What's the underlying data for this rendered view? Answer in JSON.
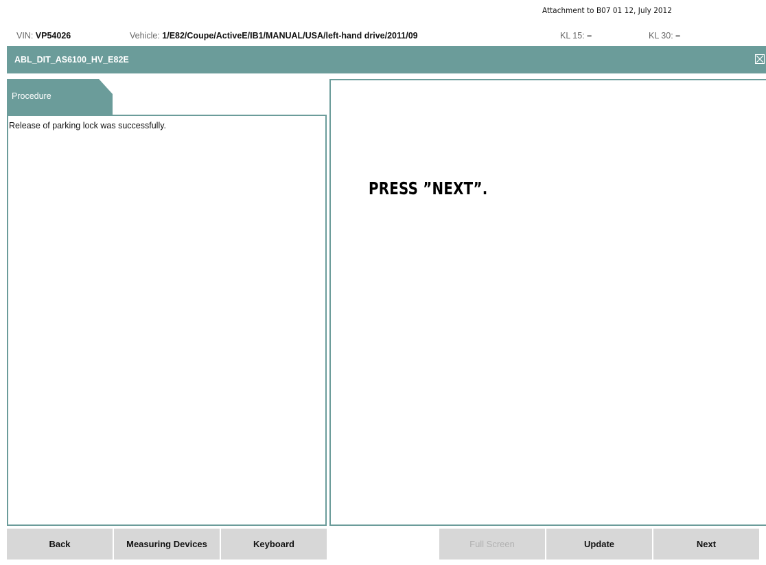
{
  "attachment_note": "Attachment to B07 01 12, July 2012",
  "vehicle_bar": {
    "vin_label": "VIN:",
    "vin_value": "VP54026",
    "vehicle_label": "Vehicle:",
    "vehicle_value": "1/E82/Coupe/ActiveE/IB1/MANUAL/USA/left-hand drive/2011/09",
    "kl15_label": "KL 15:",
    "kl15_value": "–",
    "kl30_label": "KL 30:",
    "kl30_value": "–"
  },
  "window": {
    "title": "ABL_DIT_AS6100_HV_E82E",
    "close_icon": "close-icon"
  },
  "procedure": {
    "tab_label": "Procedure",
    "text": "Release of parking lock was successfully."
  },
  "instruction": {
    "text": "PRESS ”NEXT”."
  },
  "buttons": {
    "back": "Back",
    "measuring_devices": "Measuring Devices",
    "keyboard": "Keyboard",
    "full_screen": "Full Screen",
    "update": "Update",
    "next": "Next"
  },
  "colors": {
    "accent": "#6b9c9a",
    "button_bg": "#d7d7d7",
    "disabled_text": "#b0b0b0"
  }
}
